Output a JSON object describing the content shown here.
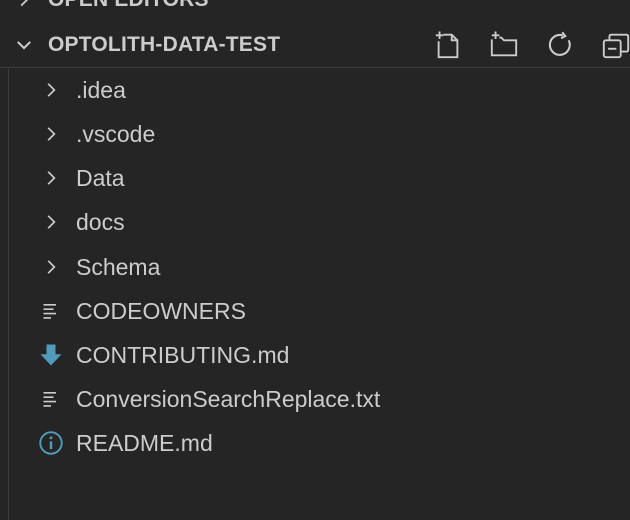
{
  "explorer": {
    "open_editors_label": "OPEN EDITORS",
    "project_name": "OPTOLITH-DATA-TEST",
    "actions": [
      {
        "name": "new-file",
        "icon": "new-file-icon"
      },
      {
        "name": "new-folder",
        "icon": "new-folder-icon"
      },
      {
        "name": "refresh",
        "icon": "refresh-icon"
      },
      {
        "name": "collapse-all",
        "icon": "collapse-all-icon"
      }
    ]
  },
  "tree": {
    "items": [
      {
        "label": ".idea",
        "kind": "folder",
        "icon": "chevron-right-icon"
      },
      {
        "label": ".vscode",
        "kind": "folder",
        "icon": "chevron-right-icon"
      },
      {
        "label": "Data",
        "kind": "folder",
        "icon": "chevron-right-icon"
      },
      {
        "label": "docs",
        "kind": "folder",
        "icon": "chevron-right-icon"
      },
      {
        "label": "Schema",
        "kind": "folder",
        "icon": "chevron-right-icon"
      },
      {
        "label": "CODEOWNERS",
        "kind": "file",
        "icon": "text-file-icon"
      },
      {
        "label": "CONTRIBUTING.md",
        "kind": "file",
        "icon": "markdown-download-icon"
      },
      {
        "label": "ConversionSearchReplace.txt",
        "kind": "file",
        "icon": "text-file-icon"
      },
      {
        "label": "README.md",
        "kind": "file",
        "icon": "info-icon"
      }
    ]
  },
  "colors": {
    "background": "#252526",
    "text": "#cccccc",
    "markdown_icon": "#519aba",
    "info_icon": "#519aba"
  }
}
